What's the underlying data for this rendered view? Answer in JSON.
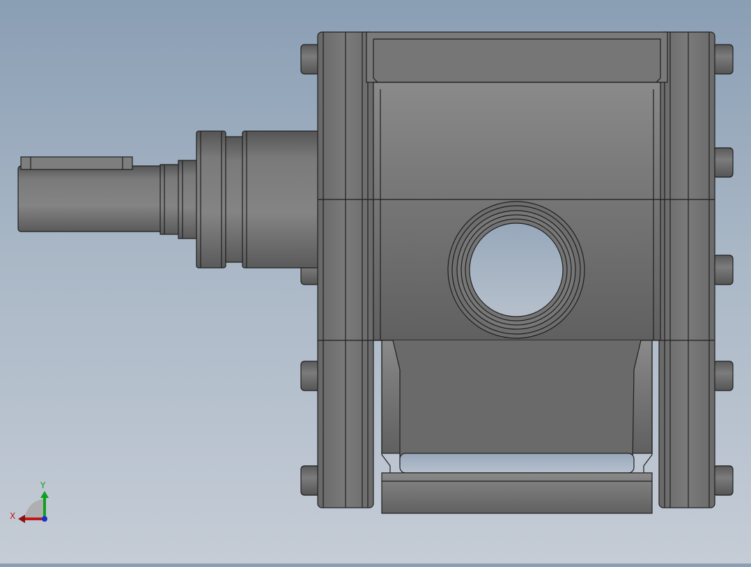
{
  "app": {
    "view_mode": "front-view",
    "background": "gradient-blue-gray"
  },
  "model": {
    "kind": "gear-pump-housing",
    "features": [
      "drive-shaft",
      "key",
      "flange",
      "body",
      "port-hole",
      "end-caps",
      "bolts",
      "mounting-foot"
    ],
    "colors": {
      "body": "#707070",
      "edge": "#1e1e1e",
      "hole": "#a8b4c2"
    }
  },
  "triad": {
    "x_label": "X",
    "y_label": "Y",
    "colors": {
      "x": "#c01818",
      "y": "#10a020",
      "z": "#1830c8"
    }
  }
}
